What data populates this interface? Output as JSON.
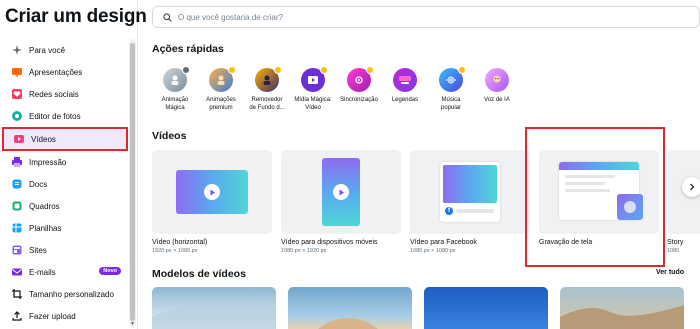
{
  "sidebar": {
    "title": "Criar um design",
    "items": [
      {
        "label": "Para você",
        "icon": "sparkle-icon",
        "color": "#5a6570"
      },
      {
        "label": "Apresentações",
        "icon": "presentation-icon",
        "color": "#ff6a00"
      },
      {
        "label": "Redes sociais",
        "icon": "heart-icon",
        "color": "#ff3860"
      },
      {
        "label": "Editor de fotos",
        "icon": "photo-edit-icon",
        "color": "#14b0a5"
      },
      {
        "label": "Vídeos",
        "icon": "video-icon",
        "color": "#ff3a7a",
        "active": true
      },
      {
        "label": "Impressão",
        "icon": "printer-icon",
        "color": "#7d2ae8"
      },
      {
        "label": "Docs",
        "icon": "docs-icon",
        "color": "#13a3ff"
      },
      {
        "label": "Quadros",
        "icon": "whiteboard-icon",
        "color": "#16b36b"
      },
      {
        "label": "Planilhas",
        "icon": "sheets-icon",
        "color": "#13a3ff"
      },
      {
        "label": "Sites",
        "icon": "website-icon",
        "color": "#8b5cf6"
      },
      {
        "label": "E-mails",
        "icon": "email-icon",
        "color": "#7d2ae8",
        "badge": "Novo"
      },
      {
        "label": "Tamanho personalizado",
        "icon": "crop-icon",
        "color": "#0e1318"
      },
      {
        "label": "Fazer upload",
        "icon": "upload-icon",
        "color": "#0e1318"
      }
    ]
  },
  "search": {
    "placeholder": "O que você gostaria de criar?"
  },
  "quick_actions": {
    "title": "Ações rápidas",
    "items": [
      {
        "label1": "Animação",
        "label2": "Mágica"
      },
      {
        "label1": "Animações",
        "label2": "premium"
      },
      {
        "label1": "Removedor",
        "label2": "de Fundo d..."
      },
      {
        "label1": "Mídia Mágica:",
        "label2": "Vídeo"
      },
      {
        "label1": "Sincronização",
        "label2": ""
      },
      {
        "label1": "Legendas",
        "label2": ""
      },
      {
        "label1": "Música",
        "label2": "popular"
      },
      {
        "label1": "Voz de IA",
        "label2": ""
      }
    ]
  },
  "videos": {
    "title": "Vídeos",
    "cards": [
      {
        "title": "Vídeo (horizontal)",
        "size": "1920 px × 1080 px"
      },
      {
        "title": "Vídeo para dispositivos móveis",
        "size": "1080 px × 1920 px"
      },
      {
        "title": "Vídeo para Facebook",
        "size": "1080 px × 1080 px"
      },
      {
        "title": "Gravação de tela",
        "size": ""
      },
      {
        "title": "Story",
        "size": "1080"
      }
    ]
  },
  "models": {
    "title": "Modelos de vídeos",
    "see_all": "Ver tudo"
  },
  "colors": {
    "accent": "#7d2ae8",
    "highlight": "#e0282e"
  }
}
